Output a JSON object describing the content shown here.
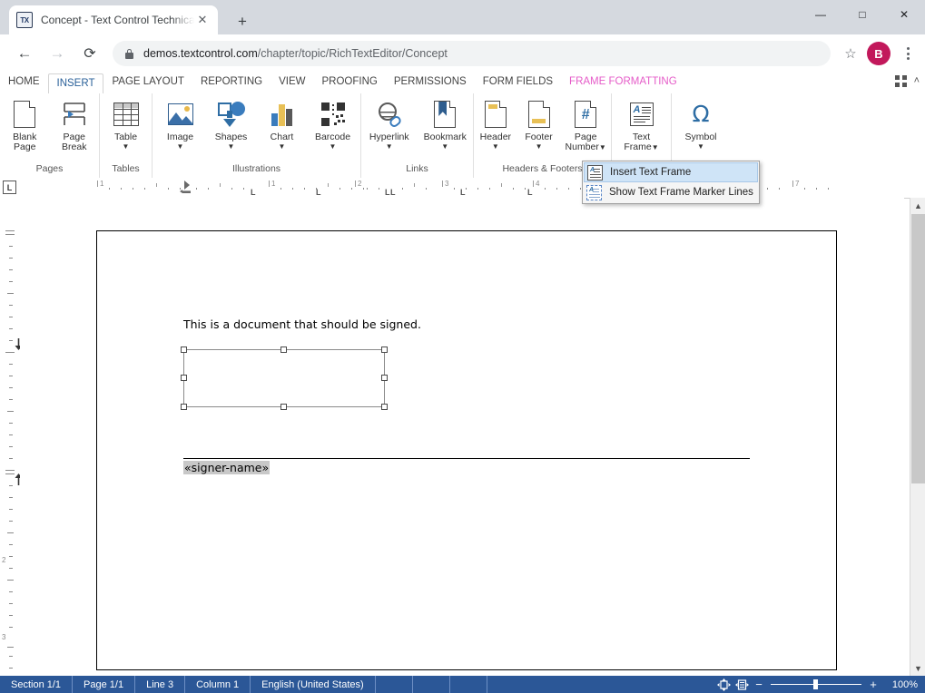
{
  "browser": {
    "tab": {
      "favicon_text": "TX",
      "title": "Concept - Text Control Technical ",
      "close_label": "✕"
    },
    "new_tab_label": "+",
    "window_controls": {
      "minimize": "—",
      "maximize": "□",
      "close": "✕"
    },
    "nav": {
      "back": "←",
      "forward": "→",
      "reload": "⟳"
    },
    "address": {
      "domain": "demos.textcontrol.com",
      "path": "/chapter/topic/RichTextEditor/Concept",
      "lock_icon": "lock-icon"
    },
    "star_label": "☆",
    "avatar_initial": "B"
  },
  "ribbon": {
    "tabs": [
      {
        "label": "HOME",
        "active": false,
        "contextual": false
      },
      {
        "label": "INSERT",
        "active": true,
        "contextual": false
      },
      {
        "label": "PAGE LAYOUT",
        "active": false,
        "contextual": false
      },
      {
        "label": "REPORTING",
        "active": false,
        "contextual": false
      },
      {
        "label": "VIEW",
        "active": false,
        "contextual": false
      },
      {
        "label": "PROOFING",
        "active": false,
        "contextual": false
      },
      {
        "label": "PERMISSIONS",
        "active": false,
        "contextual": false
      },
      {
        "label": "FORM FIELDS",
        "active": false,
        "contextual": false
      },
      {
        "label": "FRAME FORMATTING",
        "active": false,
        "contextual": true
      }
    ],
    "contextual_color": "#e55bc8",
    "active_tab_color": "#2a6099",
    "collapse_icon": "collapse-ribbon-icon",
    "caret_up": "˄",
    "groups": [
      {
        "name": "Pages",
        "label": "Pages",
        "buttons": [
          {
            "name": "blank-page",
            "line1": "Blank",
            "line2": "Page",
            "caret": false
          },
          {
            "name": "page-break",
            "line1": "Page",
            "line2": "Break",
            "caret": false
          }
        ]
      },
      {
        "name": "Tables",
        "label": "Tables",
        "buttons": [
          {
            "name": "table",
            "line1": "Table",
            "line2": "",
            "caret": true
          }
        ]
      },
      {
        "name": "Illustrations",
        "label": "Illustrations",
        "buttons": [
          {
            "name": "image",
            "line1": "Image",
            "line2": "",
            "caret": true
          },
          {
            "name": "shapes",
            "line1": "Shapes",
            "line2": "",
            "caret": true
          },
          {
            "name": "chart",
            "line1": "Chart",
            "line2": "",
            "caret": true
          },
          {
            "name": "barcode",
            "line1": "Barcode",
            "line2": "",
            "caret": true
          }
        ]
      },
      {
        "name": "Links",
        "label": "Links",
        "buttons": [
          {
            "name": "hyperlink",
            "line1": "Hyperlink",
            "line2": "",
            "caret": true
          },
          {
            "name": "bookmark",
            "line1": "Bookmark",
            "line2": "",
            "caret": true
          }
        ]
      },
      {
        "name": "HeadersFooters",
        "label": "Headers & Footers",
        "buttons": [
          {
            "name": "header",
            "line1": "Header",
            "line2": "",
            "caret": true
          },
          {
            "name": "footer",
            "line1": "Footer",
            "line2": "",
            "caret": true
          },
          {
            "name": "page-number",
            "line1": "Page",
            "line2": "Number",
            "caret": true
          }
        ]
      },
      {
        "name": "TextFrameGroup",
        "label": "",
        "buttons": [
          {
            "name": "text-frame",
            "line1": "Text",
            "line2": "Frame",
            "caret": true
          }
        ]
      },
      {
        "name": "SymbolGroup",
        "label": "",
        "buttons": [
          {
            "name": "symbol",
            "line1": "Symbol",
            "line2": "",
            "caret": true,
            "glyph": "Ω"
          }
        ]
      }
    ]
  },
  "dropdown": {
    "items": [
      {
        "label": "Insert Text Frame",
        "icon": "text-frame-solid-icon",
        "highlighted": true
      },
      {
        "label": "Show Text Frame Marker Lines",
        "icon": "text-frame-dashed-icon",
        "highlighted": false
      }
    ]
  },
  "ruler": {
    "corner_label": "L",
    "h_numbers": [
      "1",
      "1",
      "2",
      "3",
      "4",
      "7"
    ],
    "v_numbers": [
      "2",
      "3"
    ],
    "tab_stop_glyph": "L"
  },
  "document": {
    "paragraph": "This is a document that should be signed.",
    "merge_field": "«signer-name»",
    "text_frame_selected": true
  },
  "statusbar": {
    "cells": [
      "Section 1/1",
      "Page 1/1",
      "Line 3",
      "Column 1",
      "English (United States)"
    ],
    "zoom": {
      "minus": "−",
      "plus": "+",
      "percent": "100%",
      "value": 100
    },
    "background": "#2b5797"
  }
}
